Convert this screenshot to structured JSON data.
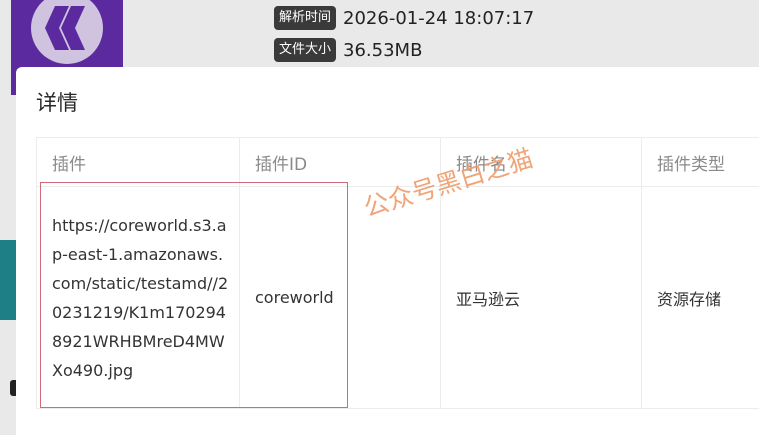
{
  "background": {
    "parse_time_label": "解析时间",
    "parse_time_value": "2026-01-24 18:07:17",
    "file_size_label": "文件大小",
    "file_size_value": "36.53MB"
  },
  "modal": {
    "title": "详情",
    "columns": [
      "插件",
      "插件ID",
      "插件名",
      "插件类型"
    ],
    "row": {
      "plugin": "https://coreworld.s3.ap-east-1.amazonaws.com/static/testamd//20231219/K1m1702948921WRHBMreD4MWXo490.jpg",
      "plugin_id": "coreworld",
      "plugin_name": "亚马逊云",
      "plugin_type": "资源存储"
    }
  },
  "watermark": "公众号黑白之猫",
  "colors": {
    "logo_bg": "#5b2a9e",
    "highlight_border": "#d06a78",
    "watermark": "#f0a070"
  }
}
